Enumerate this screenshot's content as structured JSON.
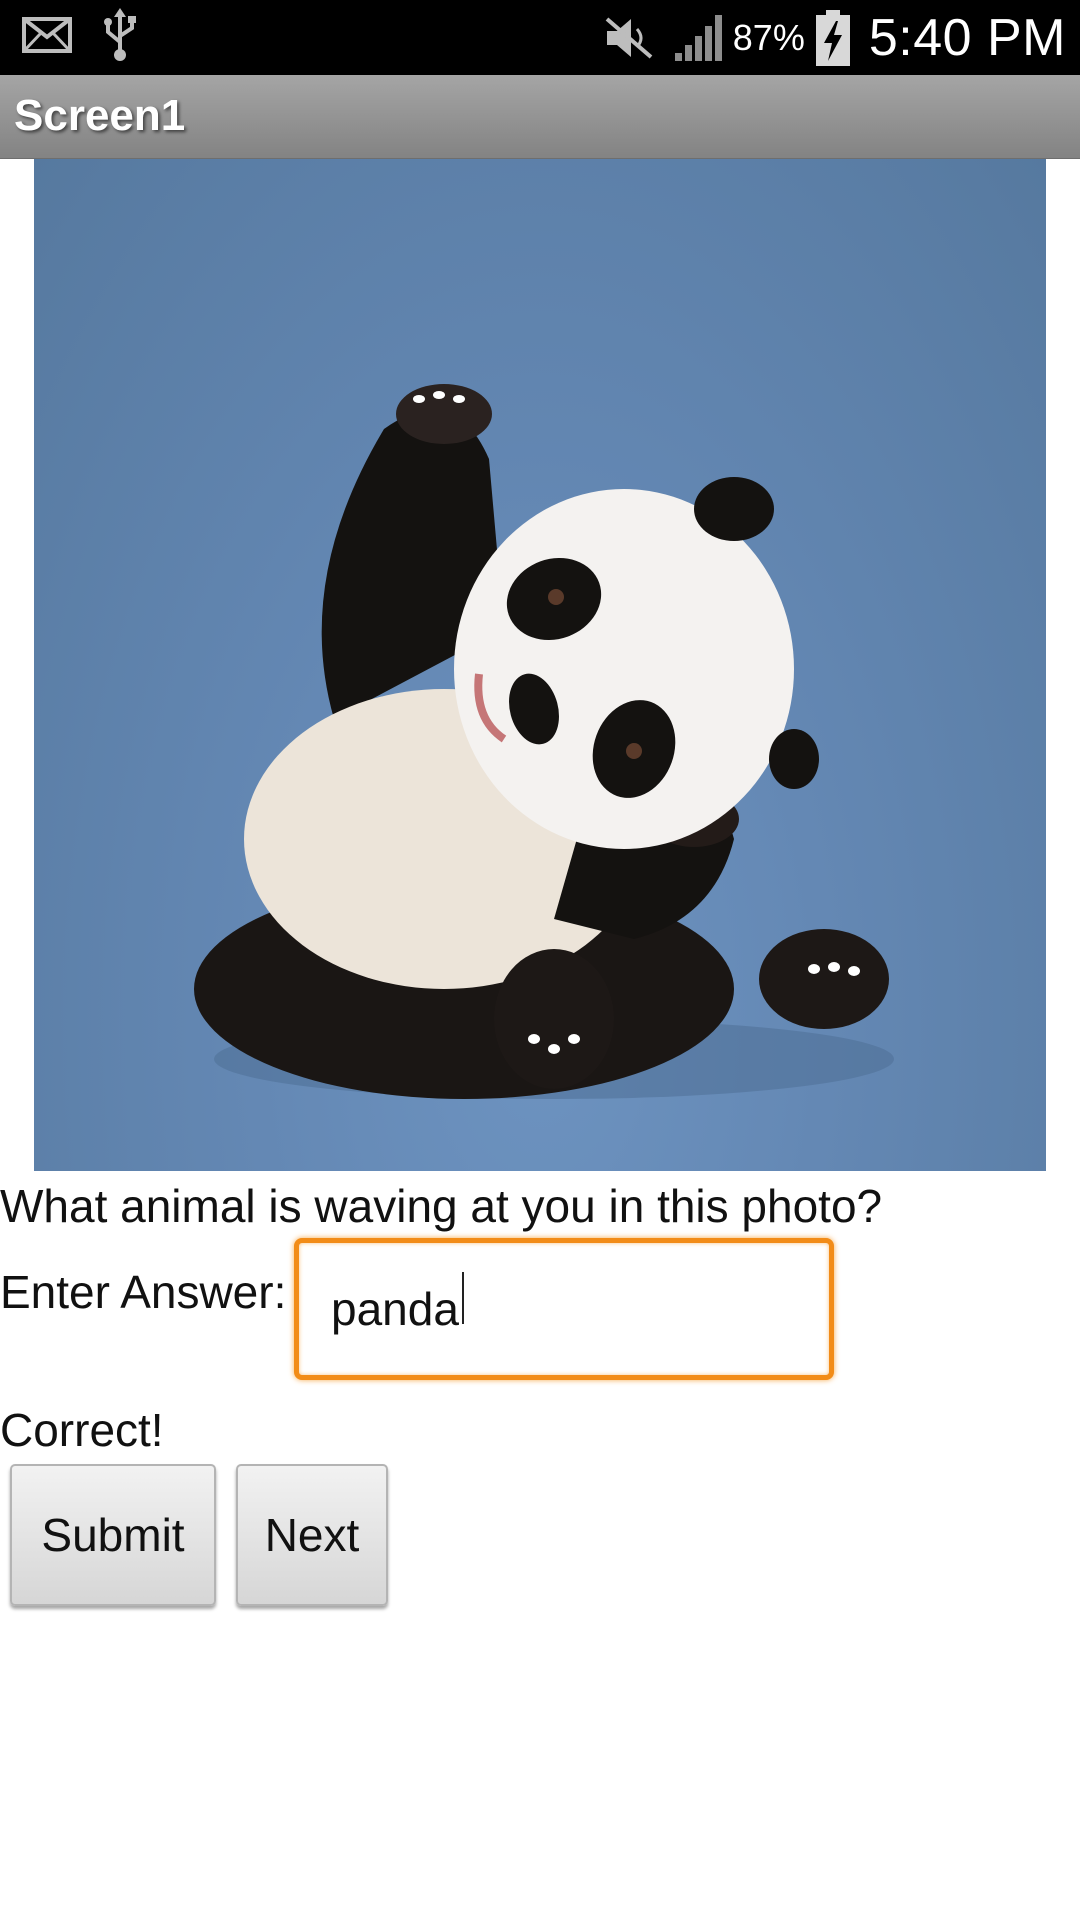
{
  "status_bar": {
    "icons_left": [
      "mail-icon",
      "usb-icon"
    ],
    "icons_right": [
      "mute-icon",
      "signal-icon",
      "battery-charging-icon"
    ],
    "battery": "87%",
    "time": "5:40 PM"
  },
  "app": {
    "title": "Screen1"
  },
  "main": {
    "photo_subject": "panda-photo",
    "question": "What animal is waving at you in this photo?",
    "answer_label": "Enter Answer:",
    "answer_value": "panda",
    "result": "Correct!",
    "buttons": {
      "submit": "Submit",
      "next": "Next"
    }
  },
  "colors": {
    "status_bar_bg": "#000000",
    "action_bar_bg": "#939393",
    "input_focus_border": "#f28c18",
    "photo_bg": "#6488b4"
  }
}
